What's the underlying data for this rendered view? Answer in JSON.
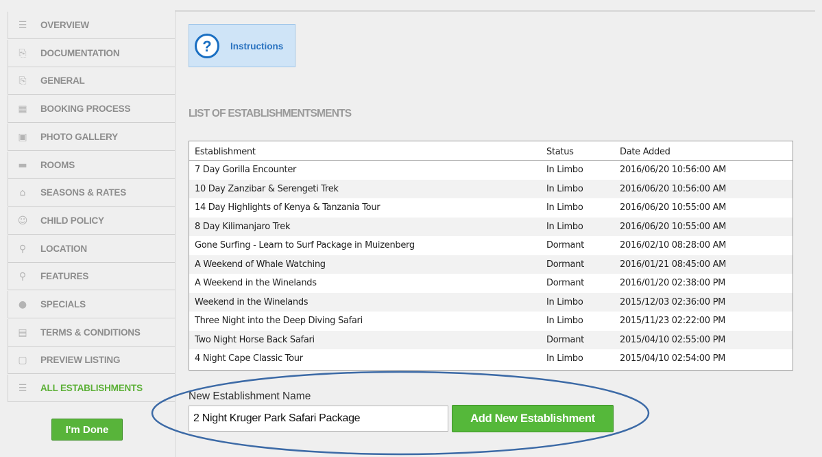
{
  "sidebar": {
    "items": [
      {
        "label": "OVERVIEW",
        "icon": "list-icon",
        "glyph": "☰"
      },
      {
        "label": "DOCUMENTATION",
        "icon": "documents-icon",
        "glyph": "⎘"
      },
      {
        "label": "GENERAL",
        "icon": "documents-icon",
        "glyph": "⎘"
      },
      {
        "label": "BOOKING PROCESS",
        "icon": "calendar-icon",
        "glyph": "▦"
      },
      {
        "label": "PHOTO GALLERY",
        "icon": "gallery-icon",
        "glyph": "▣"
      },
      {
        "label": "ROOMS",
        "icon": "bed-icon",
        "glyph": "▬"
      },
      {
        "label": "SEASONS & RATES",
        "icon": "house-icon",
        "glyph": "⌂"
      },
      {
        "label": "CHILD POLICY",
        "icon": "smiley-icon",
        "glyph": "☺"
      },
      {
        "label": "LOCATION",
        "icon": "pin-icon",
        "glyph": "⚲"
      },
      {
        "label": "FEATURES",
        "icon": "magnifier-icon",
        "glyph": "⚲"
      },
      {
        "label": "SPECIALS",
        "icon": "badge-icon",
        "glyph": "●"
      },
      {
        "label": "TERMS & CONDITIONS",
        "icon": "clipboard-icon",
        "glyph": "▤"
      },
      {
        "label": "PREVIEW LISTING",
        "icon": "preview-icon",
        "glyph": "▢"
      },
      {
        "label": "ALL ESTABLISHMENTS",
        "icon": "list-icon",
        "glyph": "☰",
        "active": true
      }
    ],
    "done_label": "I'm Done"
  },
  "instructions": {
    "label": "Instructions",
    "glyph": "?"
  },
  "list": {
    "title": "LIST OF ESTABLISHMENTSMENTS",
    "columns": [
      "Establishment",
      "Status",
      "Date Added"
    ],
    "rows": [
      [
        "7 Day Gorilla Encounter",
        "In Limbo",
        "2016/06/20 10:56:00 AM"
      ],
      [
        "10 Day Zanzibar & Serengeti Trek",
        "In Limbo",
        "2016/06/20 10:56:00 AM"
      ],
      [
        "14 Day Highlights of Kenya & Tanzania Tour",
        "In Limbo",
        "2016/06/20 10:55:00 AM"
      ],
      [
        "8 Day Kilimanjaro Trek",
        "In Limbo",
        "2016/06/20 10:55:00 AM"
      ],
      [
        "Gone Surfing - Learn to Surf Package in Muizenberg",
        "Dormant",
        "2016/02/10 08:28:00 AM"
      ],
      [
        "A Weekend of Whale Watching",
        "Dormant",
        "2016/01/21 08:45:00 AM"
      ],
      [
        "A Weekend in the Winelands",
        "Dormant",
        "2016/01/20 02:38:00 PM"
      ],
      [
        "Weekend in the Winelands",
        "In Limbo",
        "2015/12/03 02:36:00 PM"
      ],
      [
        "Three Night into the Deep Diving Safari",
        "In Limbo",
        "2015/11/23 02:22:00 PM"
      ],
      [
        "Two Night Horse Back Safari",
        "Dormant",
        "2015/04/10 02:55:00 PM"
      ],
      [
        "4 Night Cape Classic Tour",
        "In Limbo",
        "2015/04/10 02:54:00 PM"
      ]
    ]
  },
  "new_establishment": {
    "label": "New Establishment Name",
    "value": "2 Night Kruger Park Safari Package",
    "button_label": "Add New Establishment"
  },
  "colors": {
    "accent_green": "#58b43a",
    "highlight_oval": "#3c6aa6",
    "link_blue": "#2a73c0"
  }
}
